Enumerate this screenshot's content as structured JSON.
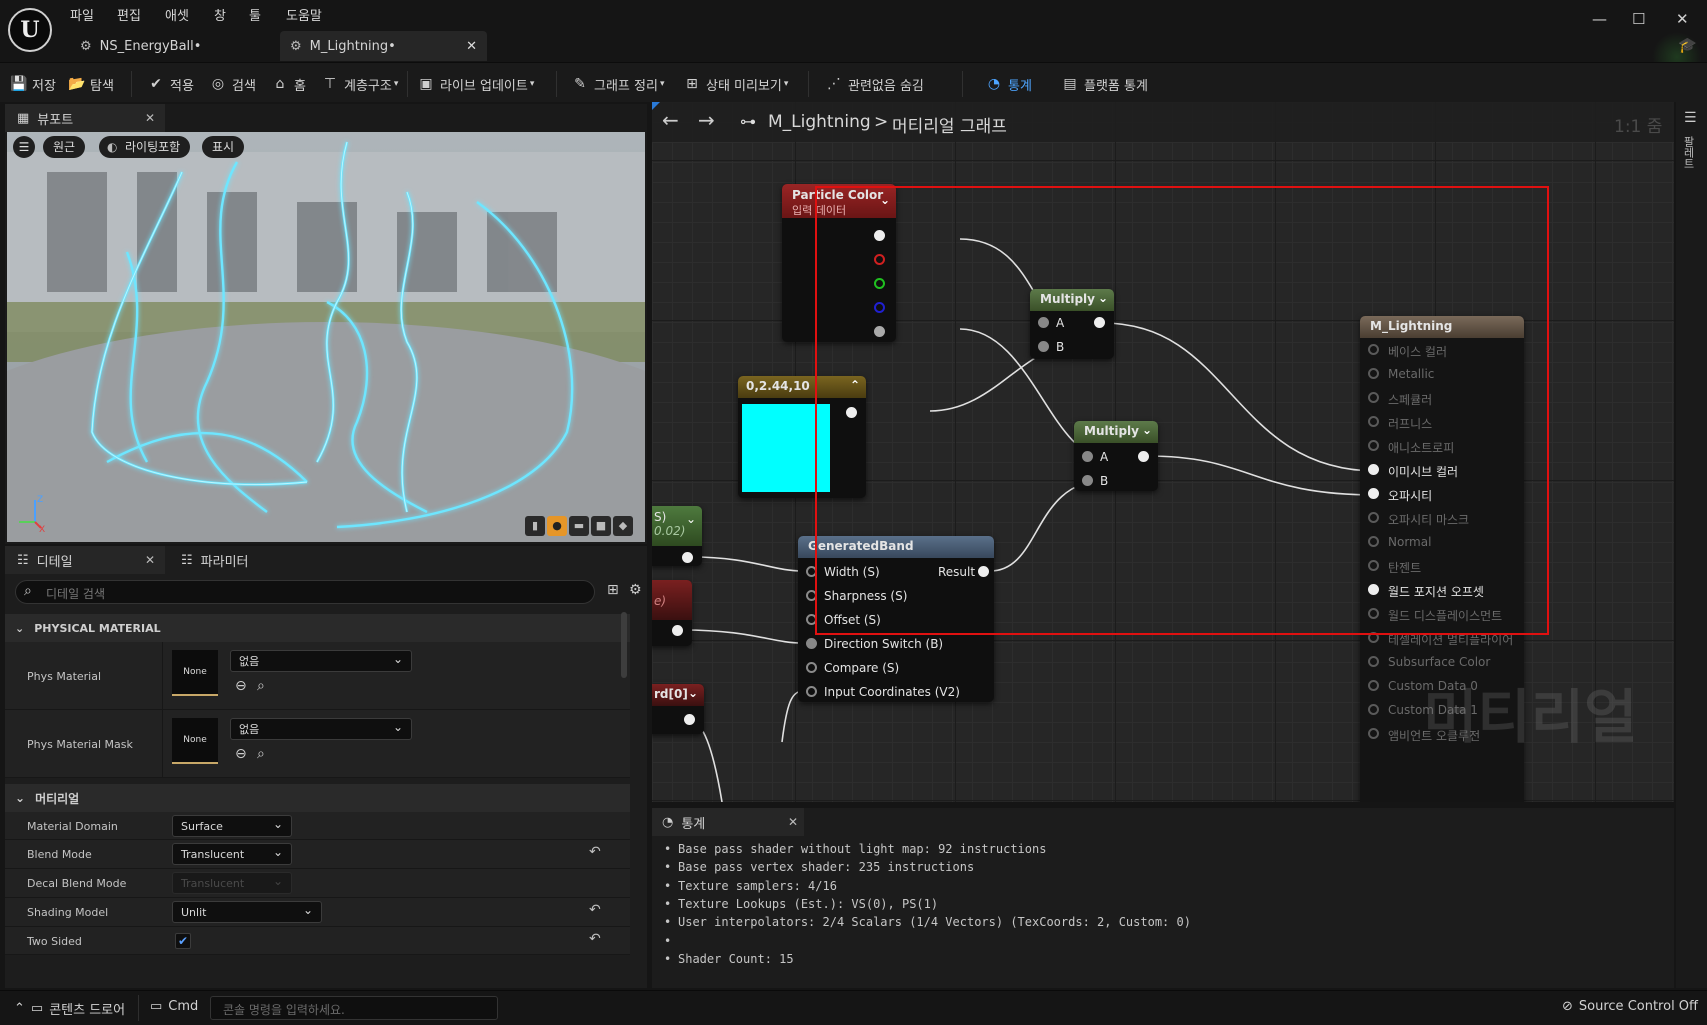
{
  "menu": [
    "파일",
    "편집",
    "애셋",
    "창",
    "툴",
    "도움말"
  ],
  "doc_tabs": [
    {
      "label": "NS_EnergyBall•"
    },
    {
      "label": "M_Lightning•"
    }
  ],
  "toolbar": {
    "save": "저장",
    "browse": "탐색",
    "apply": "적용",
    "search": "검색",
    "home": "홈",
    "hierarchy": "계층구조",
    "live_update": "라이브 업데이트",
    "clean_graph": "그래프 정리",
    "preview_state": "상태 미리보기",
    "hide_unrelated": "관련없음 숨김",
    "stats": "통계",
    "platform_stats": "플랫폼 통계"
  },
  "viewport": {
    "tab": "뷰포트",
    "btn_perspective": "원근",
    "btn_lit": "라이팅포함",
    "btn_show": "표시"
  },
  "details": {
    "tab_details": "디테일",
    "tab_params": "파라미터",
    "search_placeholder": "디테일 검색",
    "section_physical": "PHYSICAL MATERIAL",
    "section_material": "머티리얼",
    "phys_material": {
      "label": "Phys Material",
      "thumb": "None",
      "value": "없음"
    },
    "phys_material_mask": {
      "label": "Phys Material Mask",
      "thumb": "None",
      "value": "없음"
    },
    "rows": [
      {
        "label": "Material Domain",
        "value": "Surface"
      },
      {
        "label": "Blend Mode",
        "value": "Translucent"
      },
      {
        "label": "Decal Blend Mode",
        "value": "Translucent"
      },
      {
        "label": "Shading Model",
        "value": "Unlit"
      },
      {
        "label": "Two Sided",
        "value": ""
      }
    ]
  },
  "graph": {
    "breadcrumb_asset": "M_Lightning",
    "breadcrumb_sep": ">",
    "breadcrumb_graph": "머티리얼 그래프",
    "zoom": "1:1 줌",
    "palette_label": "팔레트",
    "watermark": "머티리얼",
    "particle_color": {
      "title": "Particle Color",
      "subtitle": "입력 데이터"
    },
    "multiply1": {
      "title": "Multiply",
      "a": "A",
      "b": "B"
    },
    "multiply2": {
      "title": "Multiply",
      "a": "A",
      "b": "B"
    },
    "constant": {
      "title": "0,2.44,10",
      "color": "#00ffff"
    },
    "generated_band": {
      "title": "GeneratedBand",
      "result": "Result",
      "inputs": [
        "Width (S)",
        "Sharpness (S)",
        "Offset (S)",
        "Direction Switch (B)",
        "Compare (S)",
        "Input Coordinates (V2)"
      ]
    },
    "partial_nodes": [
      "S)",
      "0.02)",
      "e)",
      "rd[0]"
    ],
    "result_node": {
      "title": "M_Lightning",
      "pins": [
        {
          "label": "베이스 컬러",
          "active": false
        },
        {
          "label": "Metallic",
          "active": false
        },
        {
          "label": "스페큘러",
          "active": false
        },
        {
          "label": "러프니스",
          "active": false
        },
        {
          "label": "애니소트로피",
          "active": false
        },
        {
          "label": "이미시브 컬러",
          "active": true
        },
        {
          "label": "오파시티",
          "active": true
        },
        {
          "label": "오파시티 마스크",
          "active": false
        },
        {
          "label": "Normal",
          "active": false
        },
        {
          "label": "탄젠트",
          "active": false
        },
        {
          "label": "월드 포지션 오프셋",
          "active": true
        },
        {
          "label": "월드 디스플레이스먼트",
          "active": false
        },
        {
          "label": "테셀레이션 멀티플라이어",
          "active": false
        },
        {
          "label": "Subsurface Color",
          "active": false
        },
        {
          "label": "Custom Data 0",
          "active": false
        },
        {
          "label": "Custom Data 1",
          "active": false
        },
        {
          "label": "앰비언트 오클루전",
          "active": false
        }
      ]
    }
  },
  "stats": {
    "tab": "통계",
    "lines": [
      "Base pass shader without light map: 92 instructions",
      "Base pass vertex shader: 235 instructions",
      "Texture samplers: 4/16",
      "Texture Lookups (Est.): VS(0), PS(1)",
      "User interpolators: 2/4 Scalars (1/4 Vectors) (TexCoords: 2, Custom: 0)",
      "",
      "Shader Count: 15"
    ]
  },
  "statusbar": {
    "content_drawer": "콘텐츠 드로어",
    "cmd": "Cmd",
    "cmd_placeholder": "콘솔 명령을 입력하세요.",
    "source_control": "Source Control Off"
  },
  "colors": {
    "highlight_box": "#e01010",
    "particle_header": "#8a1c1c",
    "multiply_header": "#4a6a3a",
    "constant_header": "#6a5a20",
    "band_header": "#4a5d72",
    "result_header": "#6a5a4a"
  }
}
